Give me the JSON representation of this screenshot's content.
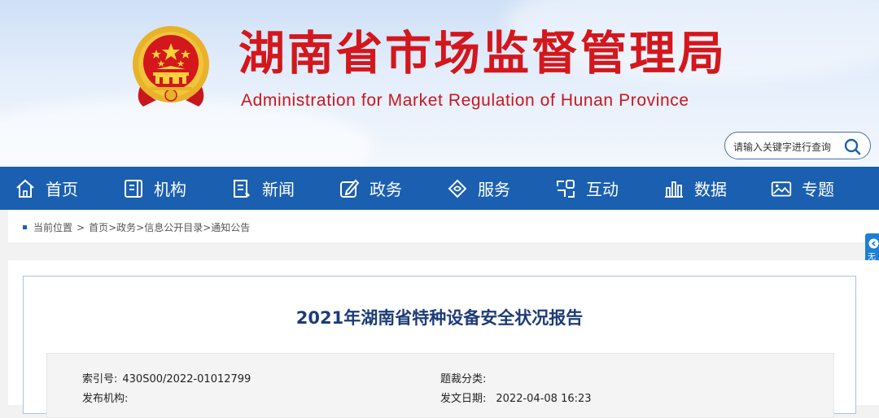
{
  "header": {
    "title": "湖南省市场监督管理局",
    "subtitle": "Administration for Market Regulation of Hunan Province",
    "search_placeholder": "请输入关键字进行查询"
  },
  "nav": [
    {
      "label": "首页",
      "icon": "home-icon"
    },
    {
      "label": "机构",
      "icon": "organization-icon"
    },
    {
      "label": "新闻",
      "icon": "news-icon"
    },
    {
      "label": "政务",
      "icon": "edit-icon"
    },
    {
      "label": "服务",
      "icon": "service-icon"
    },
    {
      "label": "互动",
      "icon": "interaction-icon"
    },
    {
      "label": "数据",
      "icon": "data-chart-icon"
    },
    {
      "label": "专题",
      "icon": "image-icon"
    }
  ],
  "breadcrumb": {
    "prefix": "当前位置",
    "sep": ">",
    "path": "首页>政务>信息公开目录>通知公告"
  },
  "side_tab": {
    "label": "无障碍浏览"
  },
  "article": {
    "title": "2021年湖南省特种设备安全状况报告",
    "index_label": "索引号:",
    "index_value": "430S00/2022-01012799",
    "category_label": "题裁分类:",
    "category_value": "",
    "issuer_label": "发布机构:",
    "issuer_value": "",
    "date_label": "发文日期:",
    "date_value": "2022-04-08 16:23"
  },
  "colors": {
    "nav_bg": "#1b5fb0",
    "title_red": "#d3171c",
    "article_title": "#1d3c78"
  }
}
